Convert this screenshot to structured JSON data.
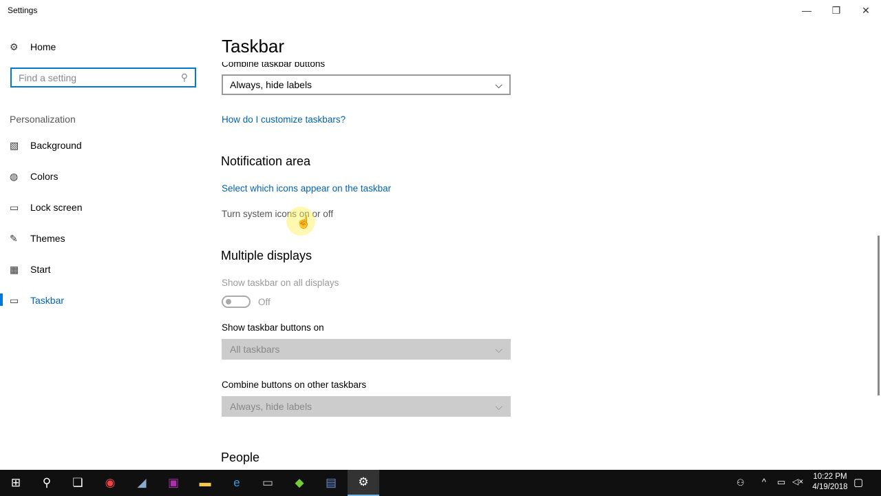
{
  "window": {
    "title": "Settings",
    "minimize": "—",
    "maximize": "❐",
    "close": "✕"
  },
  "sidebar": {
    "home": "Home",
    "search_placeholder": "Find a setting",
    "section": "Personalization",
    "items": [
      {
        "label": "Background",
        "icon": "▧"
      },
      {
        "label": "Colors",
        "icon": "◍"
      },
      {
        "label": "Lock screen",
        "icon": "▭"
      },
      {
        "label": "Themes",
        "icon": "✎"
      },
      {
        "label": "Start",
        "icon": "▦"
      },
      {
        "label": "Taskbar",
        "icon": "▭"
      }
    ]
  },
  "main": {
    "title": "Taskbar",
    "combine_label": "Combine taskbar buttons",
    "combine_value": "Always, hide labels",
    "help_link": "How do I customize taskbars?",
    "notification_heading": "Notification area",
    "select_icons_link": "Select which icons appear on the taskbar",
    "system_icons_link": "Turn system icons on or off",
    "multiple_heading": "Multiple displays",
    "show_all_label": "Show taskbar on all displays",
    "toggle_state": "Off",
    "show_buttons_label": "Show taskbar buttons on",
    "show_buttons_value": "All taskbars",
    "combine_other_label": "Combine buttons on other taskbars",
    "combine_other_value": "Always, hide labels",
    "people_heading": "People"
  },
  "taskbar": {
    "time": "10:22 PM",
    "date": "4/19/2018",
    "accent": "#76b9ed"
  }
}
